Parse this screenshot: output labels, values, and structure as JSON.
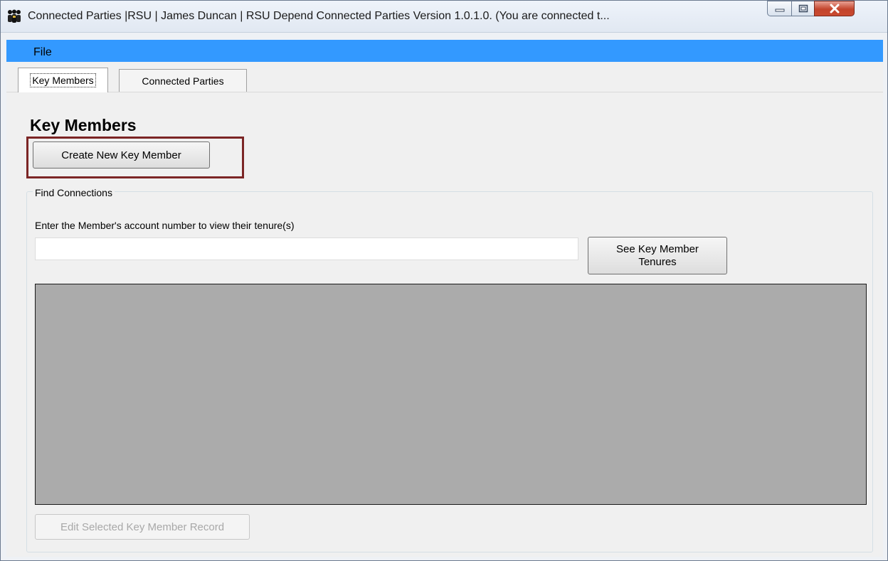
{
  "window": {
    "title": "Connected Parties |RSU | James Duncan | RSU Depend Connected Parties Version 1.0.1.0. (You are connected t..."
  },
  "menu": {
    "file_label": "File"
  },
  "tabs": [
    {
      "label": "Key Members",
      "selected": true
    },
    {
      "label": "Connected Parties",
      "selected": false
    }
  ],
  "key_members": {
    "title": "Key Members",
    "create_button_label": "Create New Key Member"
  },
  "find_connections": {
    "legend": "Find Connections",
    "instruction": "Enter the Member's account number to view their tenure(s)",
    "account_input_value": "",
    "see_tenures_button_label": "See Key Member Tenures",
    "edit_button_label": "Edit Selected Key Member Record",
    "edit_button_enabled": false
  },
  "colors": {
    "menubar": "#3399ff",
    "highlight_box": "#7b2525",
    "grid_background": "#ababab"
  },
  "icons": [
    "app-people-icon",
    "minimize-icon",
    "maximize-icon",
    "close-icon"
  ]
}
